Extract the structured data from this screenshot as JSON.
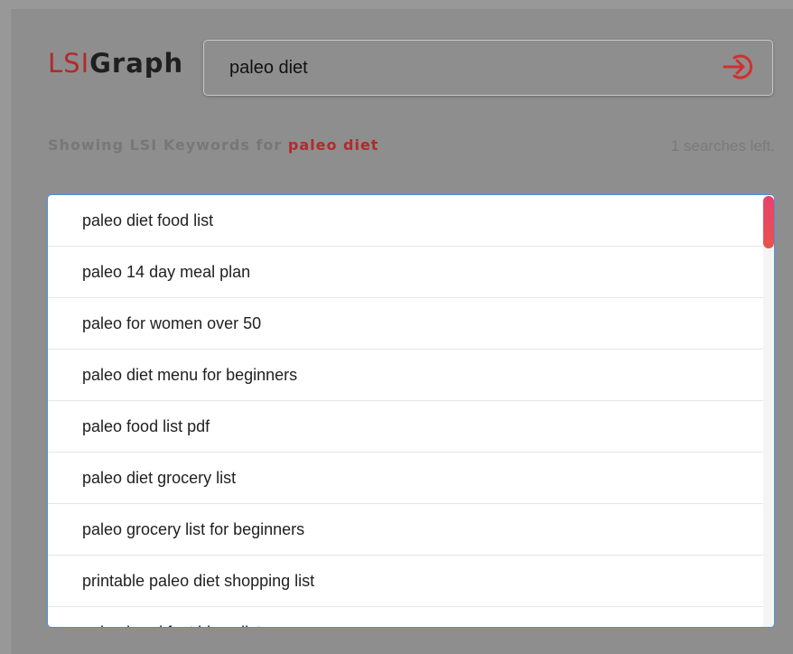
{
  "logo": {
    "part1": "LSI",
    "part2": "Graph"
  },
  "search": {
    "value": "paleo diet",
    "button_icon": "enter-arrow-icon",
    "icon_color": "#d32f2f"
  },
  "results_header": {
    "prefix": "Showing LSI Keywords for",
    "keyword": "paleo diet",
    "searches_left": "1 searches left."
  },
  "keywords": [
    "paleo diet food list",
    "paleo 14 day meal plan",
    "paleo for women over 50",
    "paleo diet menu for beginners",
    "paleo food list pdf",
    "paleo diet grocery list",
    "paleo grocery list for beginners",
    "printable paleo diet shopping list",
    "paleo breakfast ideas list"
  ],
  "colors": {
    "accent": "#b32a2a",
    "list_border": "#4a90e2",
    "scrollbar": "#e8416a"
  }
}
